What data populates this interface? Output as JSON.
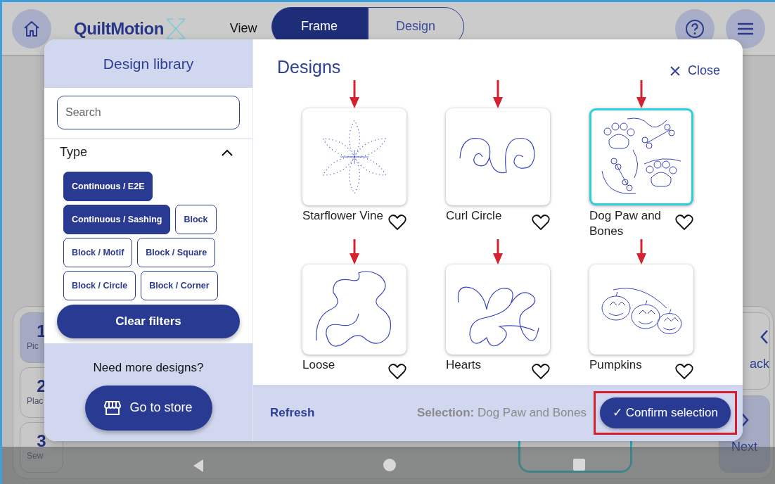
{
  "topbar": {
    "logo": "QuiltMotion",
    "view_label": "View",
    "view_tabs": [
      {
        "label": "Frame",
        "selected": true
      },
      {
        "label": "Design",
        "selected": false
      }
    ]
  },
  "steps": [
    {
      "number": "1",
      "label": "Pic",
      "selected": true
    },
    {
      "number": "2",
      "label": "Plac",
      "selected": false
    },
    {
      "number": "3",
      "label": "Sew",
      "selected": false
    }
  ],
  "side_buttons": [
    {
      "label": "ack",
      "kind": "back"
    },
    {
      "label": "Next",
      "kind": "next"
    }
  ],
  "modal": {
    "library": {
      "title": "Design library",
      "search": {
        "placeholder": "Search"
      },
      "filter": {
        "title": "Type",
        "expanded": true,
        "chips": [
          {
            "label": "Continuous / E2E",
            "selected": true
          },
          {
            "label": "Continuous / Sashing",
            "selected": true
          },
          {
            "label": "Block",
            "selected": false
          },
          {
            "label": "Block / Motif",
            "selected": false
          },
          {
            "label": "Block / Square",
            "selected": false
          },
          {
            "label": "Block / Circle",
            "selected": false
          },
          {
            "label": "Block / Corner",
            "selected": false
          }
        ]
      },
      "clear_button": "Clear filters",
      "store_prompt": "Need more designs?",
      "store_button": "Go to store"
    },
    "designs": {
      "title": "Designs",
      "close": "Close",
      "items": [
        {
          "name": "Starflower Vine",
          "selected": false,
          "favorite": false
        },
        {
          "name": "Curl Circle",
          "selected": false,
          "favorite": false
        },
        {
          "name": "Dog Paw and Bones",
          "selected": true,
          "favorite": false
        },
        {
          "name": "Loose",
          "selected": false,
          "favorite": false
        },
        {
          "name": "Hearts",
          "selected": false,
          "favorite": false
        },
        {
          "name": "Pumpkins",
          "selected": false,
          "favorite": false
        }
      ]
    },
    "footer": {
      "refresh": "Refresh",
      "selection": "**Selection:** Dog Paw and Bones",
      "confirm": "✓ Confirm selection"
    }
  }
}
